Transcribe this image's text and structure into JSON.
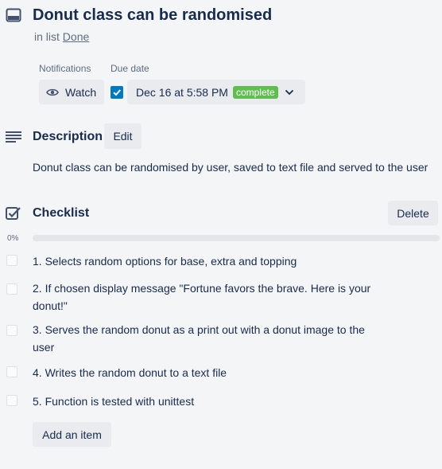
{
  "card": {
    "title": "Donut class can be randomised",
    "in_list_prefix": "in list",
    "list_name": "Done"
  },
  "notifications": {
    "label": "Notifications",
    "watch_label": "Watch"
  },
  "due": {
    "label": "Due date",
    "value": "Dec 16 at 5:58 PM",
    "badge": "complete",
    "checked": true
  },
  "description": {
    "heading": "Description",
    "edit_label": "Edit",
    "text": "Donut class can be randomised by user, saved to text file and served to the user"
  },
  "checklist": {
    "heading": "Checklist",
    "delete_label": "Delete",
    "percent": "0%",
    "progress": 0,
    "items": [
      {
        "text": "1. Selects random options for base, extra and topping",
        "checked": false
      },
      {
        "text": "2. If chosen display message \"Fortune favors the brave. Here is your donut!\"",
        "checked": false
      },
      {
        "text": "3. Serves the random donut as a print out with a donut image to the user",
        "checked": false
      },
      {
        "text": "4. Writes the random donut to a text file",
        "checked": false
      },
      {
        "text": "5. Function is tested with unittest",
        "checked": false
      }
    ],
    "add_label": "Add an item"
  },
  "colors": {
    "accent": "#0079bf",
    "complete": "#61bd4f",
    "button_bg": "#e9ebee",
    "text": "#172b4d",
    "subtle": "#5e6c84"
  },
  "icons": [
    "card-icon",
    "eye-icon",
    "checkbox-checked-icon",
    "chevron-down-icon",
    "description-icon",
    "checklist-icon"
  ]
}
